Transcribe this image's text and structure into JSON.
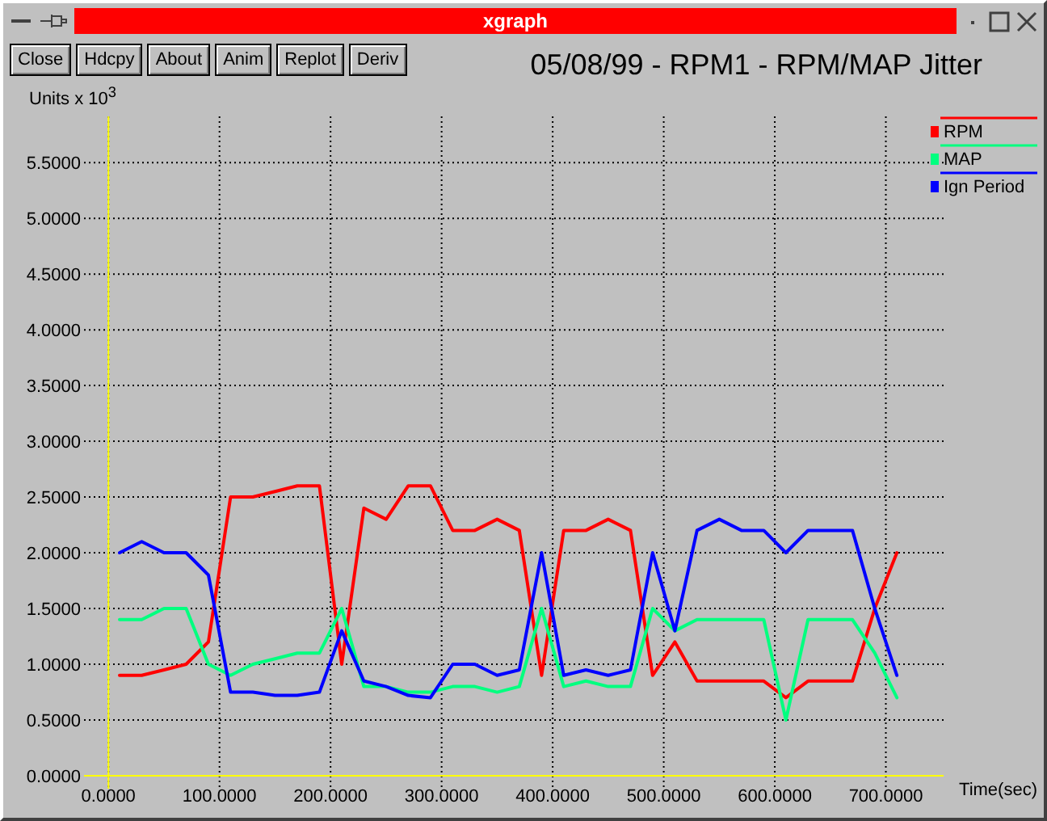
{
  "window": {
    "title": "xgraph"
  },
  "toolbar": [
    "Close",
    "Hdcpy",
    "About",
    "Anim",
    "Replot",
    "Deriv"
  ],
  "plot_title": "05/08/99 - RPM1 - RPM/MAP Jitter",
  "chart": {
    "chart_data": {
      "type": "line",
      "grid": true,
      "legend": "right",
      "xlabel": "Time(sec)",
      "ylabel": "Units x 10$^{3}$",
      "xlim": [
        -22,
        752
      ],
      "ylim": [
        0,
        5.9
      ],
      "x": [
        10,
        30,
        50,
        70,
        90,
        110,
        130,
        150,
        170,
        190,
        210,
        230,
        250,
        270,
        290,
        310,
        330,
        350,
        370,
        390,
        410,
        430,
        450,
        470,
        490,
        510,
        530,
        550,
        570,
        590,
        610,
        630,
        650,
        670,
        690,
        710
      ],
      "series": [
        {
          "name": "RPM",
          "color": "#ff0000",
          "values": [
            0.9,
            0.9,
            0.95,
            1.0,
            1.2,
            2.5,
            2.5,
            2.55,
            2.6,
            2.6,
            1.0,
            2.4,
            2.3,
            2.6,
            2.6,
            2.2,
            2.2,
            2.3,
            2.2,
            0.9,
            2.2,
            2.2,
            2.3,
            2.2,
            0.9,
            1.2,
            0.85,
            0.85,
            0.85,
            0.85,
            0.7,
            0.85,
            0.85,
            0.85,
            1.5,
            2.0
          ]
        },
        {
          "name": "MAP",
          "color": "#00ff7f",
          "values": [
            1.4,
            1.4,
            1.5,
            1.5,
            1.0,
            0.9,
            1.0,
            1.05,
            1.1,
            1.1,
            1.5,
            0.8,
            0.8,
            0.75,
            0.75,
            0.8,
            0.8,
            0.75,
            0.8,
            1.5,
            0.8,
            0.85,
            0.8,
            0.8,
            1.5,
            1.3,
            1.4,
            1.4,
            1.4,
            1.4,
            0.5,
            1.4,
            1.4,
            1.4,
            1.1,
            0.7
          ]
        },
        {
          "name": "Ign Period",
          "color": "#0000ff",
          "values": [
            2.0,
            2.1,
            2.0,
            2.0,
            1.8,
            0.75,
            0.75,
            0.72,
            0.72,
            0.75,
            1.3,
            0.85,
            0.8,
            0.72,
            0.7,
            1.0,
            1.0,
            0.9,
            0.95,
            2.0,
            0.9,
            0.95,
            0.9,
            0.95,
            2.0,
            1.3,
            2.2,
            2.3,
            2.2,
            2.2,
            2.0,
            2.2,
            2.2,
            2.2,
            1.5,
            0.9
          ]
        }
      ],
      "xticks": [
        {
          "value": 0,
          "label": "0.0000"
        },
        {
          "value": 100,
          "label": "100.0000"
        },
        {
          "value": 200,
          "label": "200.0000"
        },
        {
          "value": 300,
          "label": "300.0000"
        },
        {
          "value": 400,
          "label": "400.0000"
        },
        {
          "value": 500,
          "label": "500.0000"
        },
        {
          "value": 600,
          "label": "600.0000"
        },
        {
          "value": 700,
          "label": "700.0000"
        }
      ],
      "yticks": [
        {
          "value": 0,
          "label": "0.0000"
        },
        {
          "value": 0.5,
          "label": "0.5000"
        },
        {
          "value": 1,
          "label": "1.0000"
        },
        {
          "value": 1.5,
          "label": "1.5000"
        },
        {
          "value": 2,
          "label": "2.0000"
        },
        {
          "value": 2.5,
          "label": "2.5000"
        },
        {
          "value": 3,
          "label": "3.0000"
        },
        {
          "value": 3.5,
          "label": "3.5000"
        },
        {
          "value": 4,
          "label": "4.0000"
        },
        {
          "value": 4.5,
          "label": "4.5000"
        },
        {
          "value": 5,
          "label": "5.0000"
        },
        {
          "value": 5.5,
          "label": "5.5000"
        }
      ]
    }
  }
}
